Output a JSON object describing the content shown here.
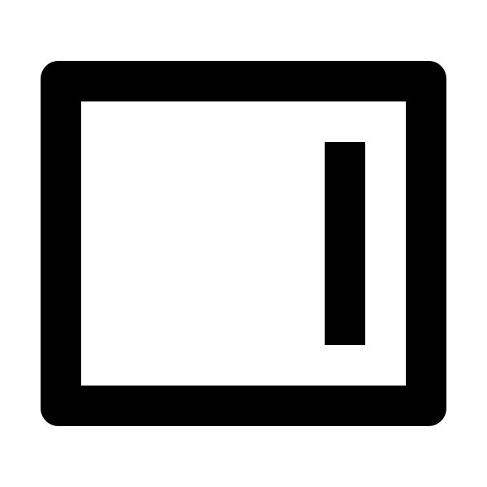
{
  "icon": {
    "name": "sidebar-right-panel-icon",
    "stroke_color": "#000000",
    "fill_color": "#ffffff"
  },
  "background": "#ffffff"
}
